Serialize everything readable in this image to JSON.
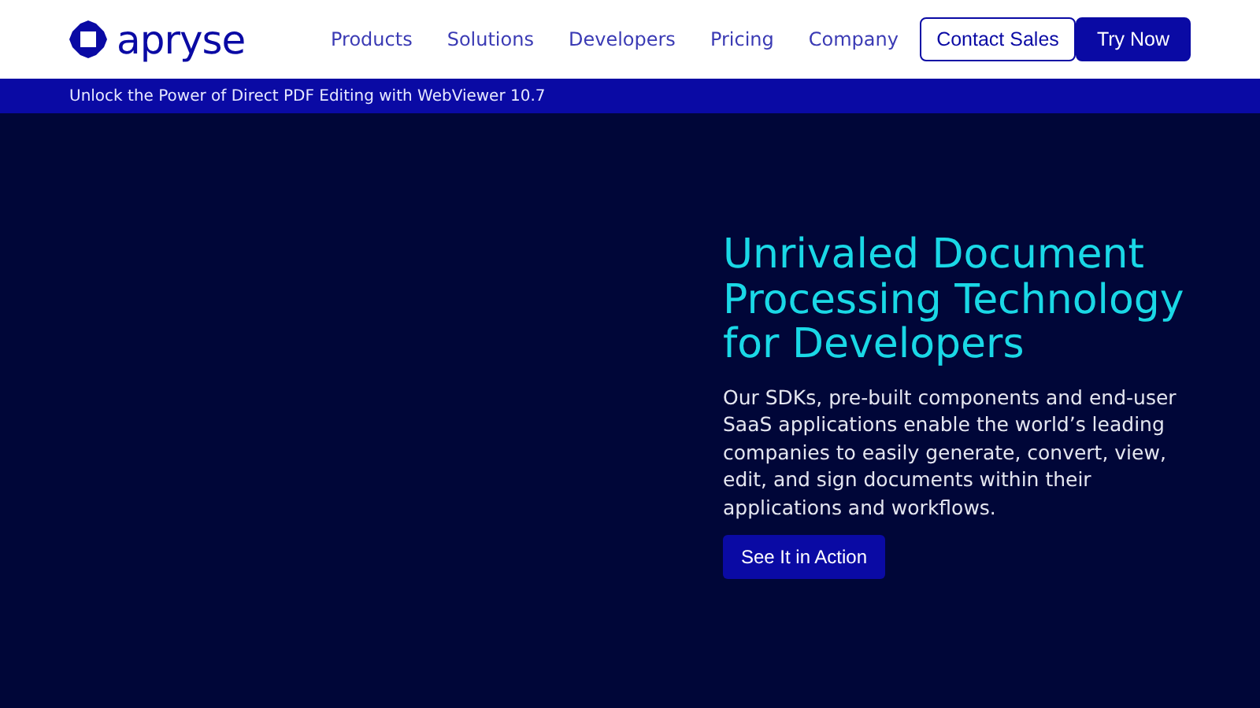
{
  "header": {
    "logo": "apryse",
    "nav": [
      "Products",
      "Solutions",
      "Developers",
      "Pricing",
      "Company"
    ],
    "buttons": [
      {
        "label": "Contact Sales",
        "kind": "outline"
      },
      {
        "label": "Try Now",
        "kind": "filled"
      }
    ]
  },
  "banner": "Unlock the Power of Direct PDF Editing with WebViewer 10.7",
  "hero": {
    "title": "Unrivaled Document Processing Technology for Developers",
    "text": "Our SDKs, pre-built components and end-user SaaS applications enable the world’s leading companies to easily generate, convert, view, edit, and sign documents within their applications and workflows.",
    "button": "See It in Action"
  }
}
